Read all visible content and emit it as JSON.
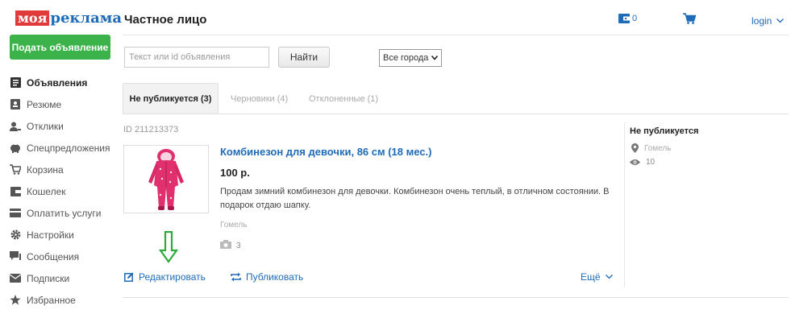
{
  "logo": {
    "part1": "моя",
    "part2": "реклама"
  },
  "sidebar": {
    "post_button": "Подать объявление",
    "items": [
      {
        "label": "Объявления",
        "icon": "listing-icon",
        "active": true
      },
      {
        "label": "Резюме",
        "icon": "resume-icon"
      },
      {
        "label": "Отклики",
        "icon": "responses-icon"
      },
      {
        "label": "Спецпредложения",
        "icon": "piggy-bank-icon"
      },
      {
        "label": "Корзина",
        "icon": "cart-icon"
      },
      {
        "label": "Кошелек",
        "icon": "wallet-icon"
      },
      {
        "label": "Оплатить услуги",
        "icon": "payment-icon"
      },
      {
        "label": "Настройки",
        "icon": "gear-icon"
      },
      {
        "label": "Сообщения",
        "icon": "messages-icon"
      },
      {
        "label": "Подписки",
        "icon": "mail-icon"
      },
      {
        "label": "Избранное",
        "icon": "star-icon"
      }
    ]
  },
  "header": {
    "title": "Частное лицо",
    "wallet_count": "0",
    "login": "login"
  },
  "search": {
    "placeholder": "Текст или id объявления",
    "button": "Найти",
    "city": "Все города"
  },
  "tabs": {
    "active": "Не публикуется (3)",
    "drafts": "Черновики (4)",
    "rejected": "Отклоненные (1)"
  },
  "listing": {
    "id": "ID 211213373",
    "title": "Комбинезон для девочки, 86 см (18 мес.)",
    "price": "100 р.",
    "description": "Продам зимний комбинезон для девочки. Комбинезон очень теплый, в отличном состоянии. В подарок отдаю шапку.",
    "city": "Гомель",
    "photos": "3",
    "actions": {
      "edit": "Редактировать",
      "publish": "Публиковать",
      "more": "Ещё"
    },
    "status": {
      "title": "Не публикуется",
      "city": "Гомель",
      "views": "10"
    }
  },
  "colors": {
    "accent": "#1e6bb8",
    "post_button": "#3cb34a",
    "logo_red": "#e03a3a",
    "arrow": "#2eaa3a",
    "product": "#e0306e"
  }
}
